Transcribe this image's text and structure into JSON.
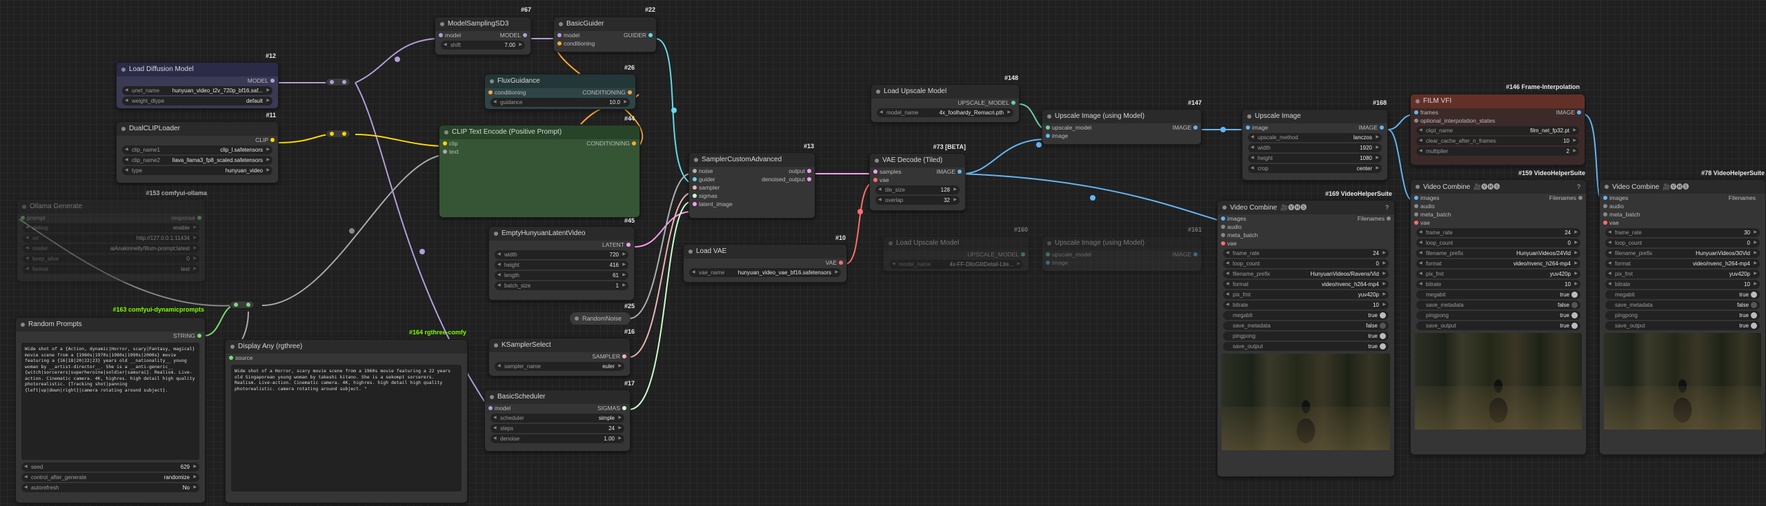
{
  "colors": {
    "model": "#b39ddb",
    "clip": "#ffd500",
    "conditioning": "#ffa931",
    "latent": "#ff9cf9",
    "image": "#64b5f6",
    "vae": "#ff6e6e",
    "guider": "#66d9e8",
    "sampler": "#ecb4b4",
    "sigmas": "#cdffcd",
    "noise": "#b0b0b0",
    "string": "#77dd77",
    "upscale": "#6ccfa8"
  },
  "nodes": {
    "model_sampling": {
      "tag": "#67",
      "title": "ModelSamplingSD3",
      "in_model": "model",
      "out_model": "MODEL",
      "shift_k": "shift",
      "shift_v": "7.00"
    },
    "basic_guider": {
      "tag": "#22",
      "title": "BasicGuider",
      "in_model": "model",
      "in_cond": "conditioning",
      "out": "GUIDER"
    },
    "load_diffusion": {
      "tag": "#12",
      "title": "Load Diffusion Model",
      "out": "MODEL",
      "unet_k": "unet_name",
      "unet_v": "hunyuan_video_t2v_720p_bf16.saf...",
      "dtype_k": "weight_dtype",
      "dtype_v": "default"
    },
    "flux_guidance": {
      "tag": "#26",
      "title": "FluxGuidance",
      "in": "conditioning",
      "out": "CONDITIONING",
      "g_k": "guidance",
      "g_v": "10.0"
    },
    "dual_clip": {
      "tag": "#11",
      "title": "DualCLIPLoader",
      "out": "CLIP",
      "c1_k": "clip_name1",
      "c1_v": "clip_l.safetensors",
      "c2_k": "clip_name2",
      "c2_v": "llava_llama3_fp8_scaled.safetensors",
      "type_k": "type",
      "type_v": "hunyuan_video"
    },
    "clip_text": {
      "tag": "#44",
      "title": "CLIP Text Encode (Positive Prompt)",
      "in_clip": "clip",
      "in_text": "text",
      "out": "CONDITIONING"
    },
    "ollama": {
      "tag": "#153 comfyui-ollama",
      "title": "Ollama Generate",
      "in_prompt": "prompt",
      "out": "response",
      "rows": [
        [
          "debug",
          "enable"
        ],
        [
          "url",
          "http://127.0.0.1:11434"
        ],
        [
          "model",
          "aiAnakinnelly/Illum-prompt:latest"
        ],
        [
          "keep_alive",
          "0"
        ],
        [
          "format",
          "text"
        ]
      ]
    },
    "empty_latent": {
      "tag": "#45",
      "title": "EmptyHunyuanLatentVideo",
      "out": "LATENT",
      "rows": [
        [
          "width",
          "720"
        ],
        [
          "height",
          "416"
        ],
        [
          "length",
          "61"
        ],
        [
          "batch_size",
          "1"
        ]
      ]
    },
    "random_noise": {
      "tag": "#25",
      "title": "RandomNoise"
    },
    "ksampler_select": {
      "tag": "#16",
      "title": "KSamplerSelect",
      "out": "SAMPLER",
      "rows": [
        [
          "sampler_name",
          "euler"
        ]
      ]
    },
    "basic_scheduler": {
      "tag": "#17",
      "title": "BasicScheduler",
      "in": "model",
      "out": "SIGMAS",
      "rows": [
        [
          "scheduler",
          "simple"
        ],
        [
          "steps",
          "24"
        ],
        [
          "denoise",
          "1.00"
        ]
      ]
    },
    "sampler_custom": {
      "tag": "#13",
      "title": "SamplerCustomAdvanced",
      "ins": [
        "noise",
        "guider",
        "sampler",
        "sigmas",
        "latent_image"
      ],
      "out1": "output",
      "out2": "denoised_output"
    },
    "load_vae": {
      "tag": "#10",
      "title": "Load VAE",
      "out": "VAE",
      "rows": [
        [
          "vae_name",
          "hunyuan_video_vae_bf16.safetensors"
        ]
      ]
    },
    "vae_decode": {
      "tag": "#73 [BETA]",
      "title": "VAE Decode (Tiled)",
      "in1": "samples",
      "in2": "vae",
      "out": "IMAGE",
      "rows": [
        [
          "tile_size",
          "128"
        ],
        [
          "overlap",
          "32"
        ]
      ]
    },
    "load_upscale": {
      "tag": "#148",
      "title": "Load Upscale Model",
      "out": "UPSCALE_MODEL",
      "rows": [
        [
          "model_name",
          "4x_foolhardy_Remacri.pth"
        ]
      ]
    },
    "upscale_image_model": {
      "tag": "#147",
      "title": "Upscale Image (using Model)",
      "in1": "upscale_model",
      "in2": "image",
      "out": "IMAGE"
    },
    "load_upscale_dim": {
      "tag": "#160",
      "title": "Load Upscale Model",
      "out": "UPSCALE_MODEL",
      "rows": [
        [
          "model_name",
          "4x-FF-DitoGlitDetail-Lite..."
        ]
      ]
    },
    "upscale_dim": {
      "tag": "#161",
      "title": "Upscale Image (using Model)",
      "in1": "upscale_model",
      "in2": "image",
      "out": "IMAGE"
    },
    "upscale_image": {
      "tag": "#168",
      "title": "Upscale Image",
      "in": "image",
      "out": "IMAGE",
      "rows": [
        [
          "upscale_method",
          "lanczos"
        ],
        [
          "width",
          "1920"
        ],
        [
          "height",
          "1080"
        ],
        [
          "crop",
          "center"
        ]
      ]
    },
    "film_vfi": {
      "tag": "#146 Frame-Interpolation",
      "title": "FILM VFI",
      "in1": "frames",
      "in2": "optional_interpolation_states",
      "out": "IMAGE",
      "rows": [
        [
          "ckpt_name",
          "film_net_fp32.pt"
        ],
        [
          "clear_cache_after_n_frames",
          "10"
        ],
        [
          "multiplier",
          "2"
        ]
      ]
    },
    "video_combine_1": {
      "tag": "#169 VideoHelperSuite",
      "title": "Video Combine",
      "icons": "🎥🅥🅗🅢",
      "ins": [
        "images",
        "audio",
        "meta_batch",
        "vae"
      ],
      "out": "Filenames",
      "rows": [
        [
          "frame_rate",
          "24"
        ],
        [
          "loop_count",
          "0"
        ],
        [
          "filename_prefix",
          "HunyuanVideos/Ravens/Vid"
        ],
        [
          "format",
          "video/nvenc_h264-mp4"
        ],
        [
          "pix_fmt",
          "yuv420p"
        ],
        [
          "bitrate",
          "10"
        ]
      ],
      "toggles": [
        [
          "megabit",
          "true"
        ],
        [
          "save_metadata",
          "false"
        ],
        [
          "pingpong",
          "true"
        ],
        [
          "save_output",
          "true"
        ]
      ]
    },
    "video_combine_2": {
      "tag": "#159 VideoHelperSuite",
      "title": "Video Combine",
      "icons": "🎥🅥🅗🅢",
      "ins": [
        "images",
        "audio",
        "meta_batch",
        "vae"
      ],
      "out": "Filenames",
      "rows": [
        [
          "frame_rate",
          "24"
        ],
        [
          "loop_count",
          "0"
        ],
        [
          "filename_prefix",
          "HunyuanVideos/24Vid"
        ],
        [
          "format",
          "video/nvenc_h264-mp4"
        ],
        [
          "pix_fmt",
          "yuv420p"
        ],
        [
          "bitrate",
          "10"
        ]
      ],
      "toggles": [
        [
          "megabit",
          "true"
        ],
        [
          "save_metadata",
          "false"
        ],
        [
          "pingpong",
          "true"
        ],
        [
          "save_output",
          "true"
        ]
      ]
    },
    "video_combine_3": {
      "tag": "#78 VideoHelperSuite",
      "title": "Video Combine",
      "icons": "🎥🅥🅗🅢",
      "ins": [
        "images",
        "audio",
        "meta_batch",
        "vae"
      ],
      "out": "Filenames",
      "rows": [
        [
          "frame_rate",
          "30"
        ],
        [
          "loop_count",
          "0"
        ],
        [
          "filename_prefix",
          "HunyuanVideos/30Vid"
        ],
        [
          "format",
          "video/nvenc_h264-mp4"
        ],
        [
          "pix_fmt",
          "yuv420p"
        ],
        [
          "bitrate",
          "10"
        ]
      ],
      "toggles": [
        [
          "megabit",
          "true"
        ],
        [
          "save_metadata",
          "false"
        ],
        [
          "pingpong",
          "true"
        ],
        [
          "save_output",
          "true"
        ]
      ]
    },
    "random_prompts": {
      "tag": "#163 comfyui-dynamicprompts",
      "title": "Random Prompts",
      "out": "STRING",
      "text": "Wide shot of a {Action, dynamic|Horror, scary|Fantasy, magical} movie scene from a {1960s|1970s|1980s|1990s|2000s} movie featuring a {16|18|20|22|23} years old __nationality__ young woman by __artist-director__. She is a __anti-generic__ {witch|sorcerers|superheroine|soldier|samurai}. Realism. Live-action. Cinematic camera. 4K, highres. high detail high quality photorealistic. {Tracking shot|panning {left|up|down|right}|camera rotating around subject}.",
      "rows": [
        [
          "seed",
          "629"
        ],
        [
          "control_after_generate",
          "randomize"
        ],
        [
          "autorefresh",
          "No"
        ]
      ]
    },
    "display_any": {
      "tag": "#164 rgthree-comfy",
      "title": "Display Any (rgthree)",
      "in": "source",
      "text": "Wide shot of a Horror, scary movie scene from a 1960s movie featuring a 22 years old Singaporean young woman by takeshi kitano. She is a sekompt sorcerers. Realism. Live-action. Cinematic camera. 4K, highres. high detail high quality photorealistic. camera rotating around subject. \""
    }
  }
}
